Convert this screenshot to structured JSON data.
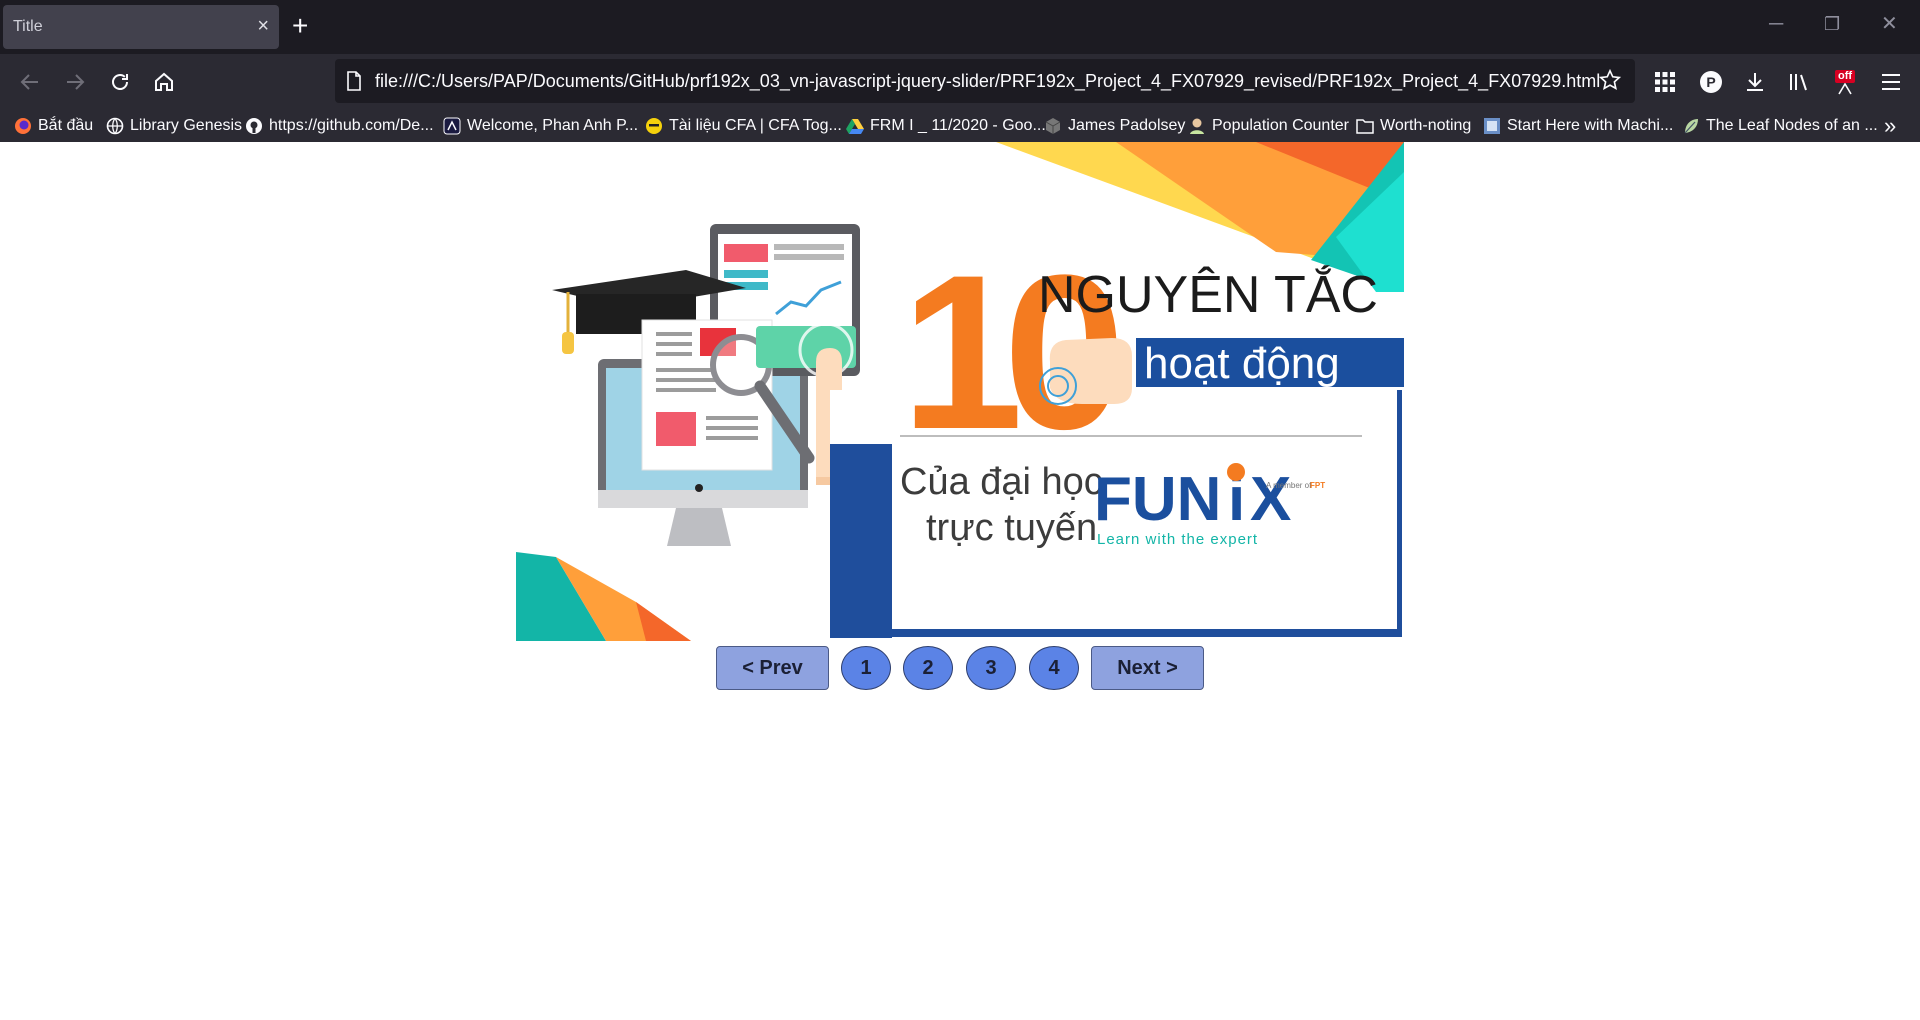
{
  "tab": {
    "title": "Title",
    "close_icon": "×",
    "new_tab_icon": "+"
  },
  "window_controls": {
    "minimize": "─",
    "restore": "❐",
    "close": "✕"
  },
  "url": "file:///C:/Users/PAP/Documents/GitHub/prf192x_03_vn-javascript-jquery-slider/PRF192x_Project_4_FX07929_revised/PRF192x_Project_4_FX07929.html",
  "extension_badge": "off",
  "bookmarks": [
    {
      "label": "Bắt đầu",
      "icon": "firefox-icon"
    },
    {
      "label": "Library Genesis",
      "icon": "globe-icon"
    },
    {
      "label": "https://github.com/De...",
      "icon": "github-icon"
    },
    {
      "label": "Welcome, Phan Anh P...",
      "icon": "site-icon"
    },
    {
      "label": "Tài liệu CFA | CFA Tog...",
      "icon": "emoji-icon"
    },
    {
      "label": "FRM I _ 11/2020 - Goo...",
      "icon": "drive-icon"
    },
    {
      "label": "James Padolsey",
      "icon": "cube-icon"
    },
    {
      "label": "Population Counter",
      "icon": "person-icon"
    },
    {
      "label": "Worth-noting",
      "icon": "folder-icon"
    },
    {
      "label": "Start Here with Machi...",
      "icon": "site-icon"
    },
    {
      "label": "The Leaf Nodes of an ...",
      "icon": "leaf-icon"
    }
  ],
  "bookmarks_overflow": "»",
  "slide": {
    "number": "10",
    "headline": "NGUYÊN TẮC",
    "subheadline": "hoạt động",
    "line1": "Của đại học",
    "line2": "trực tuyến",
    "brand_fu": "FUN",
    "brand_i": "i",
    "brand_x": "X",
    "brand_tagline": "Learn with the expert",
    "brand_member": "A member of",
    "brand_parent": "FPT"
  },
  "pager": {
    "prev_label": "< Prev",
    "next_label": "Next >",
    "pages": [
      "1",
      "2",
      "3",
      "4"
    ]
  }
}
